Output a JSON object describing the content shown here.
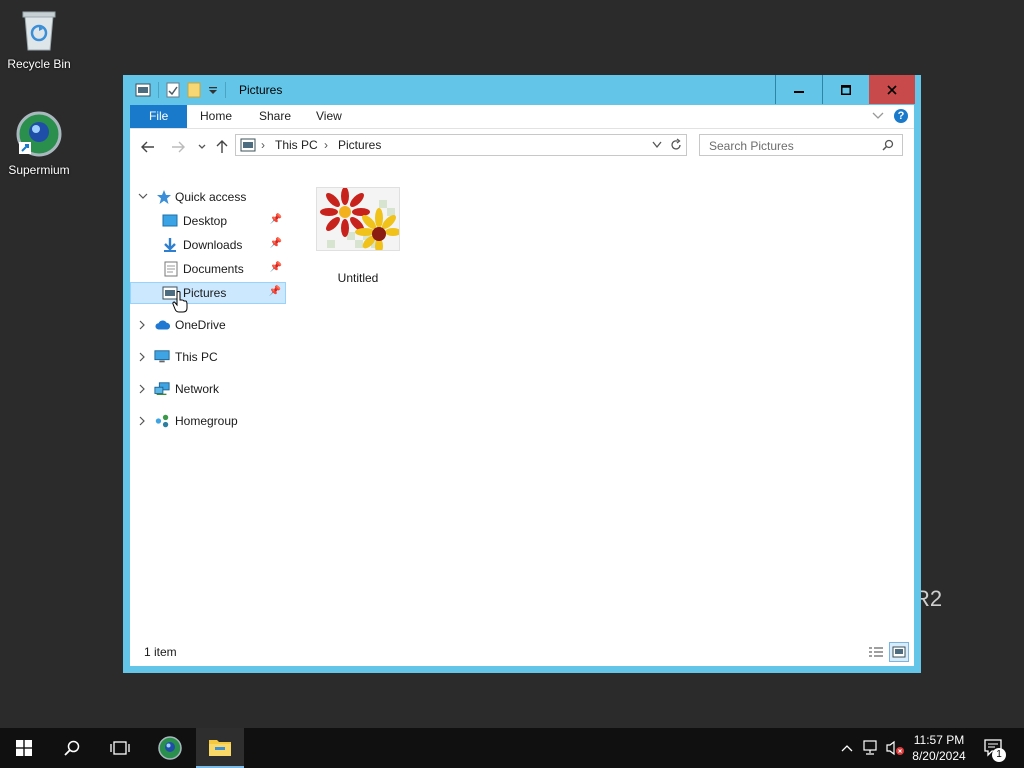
{
  "desktop": {
    "icons": [
      {
        "label": "Recycle Bin",
        "icon": "recycle-bin-icon"
      },
      {
        "label": "Supermium",
        "icon": "supermium-browser-icon"
      }
    ],
    "watermark_text": "R2"
  },
  "window": {
    "title": "Pictures",
    "controls": {
      "minimize": "minimize-icon",
      "maximize": "maximize-icon",
      "close": "close-icon"
    }
  },
  "ribbon": {
    "tabs": [
      {
        "label": "File"
      },
      {
        "label": "Home"
      },
      {
        "label": "Share"
      },
      {
        "label": "View"
      }
    ],
    "help": "?"
  },
  "navigation": {
    "breadcrumb": [
      "This PC",
      "Pictures"
    ],
    "search_placeholder": "Search Pictures"
  },
  "nav_pane": {
    "quick_access": "Quick access",
    "pinned": [
      "Desktop",
      "Downloads",
      "Documents",
      "Pictures"
    ],
    "selected": "Pictures",
    "roots": [
      "OneDrive",
      "This PC",
      "Network",
      "Homegroup"
    ]
  },
  "content": {
    "items": [
      {
        "name": "Untitled",
        "icon": "image-thumbnail-icon"
      }
    ]
  },
  "status": {
    "item_count": "1 item"
  },
  "taskbar": {
    "clock_time": "11:57 PM",
    "clock_date": "8/20/2024",
    "notification_count": "1",
    "accent": "#7dbbe8"
  },
  "colors": {
    "window_frame": "#63c6e8",
    "file_tab": "#1979ca",
    "selection": "#cce8ff",
    "close_button": "#c94a4a"
  }
}
